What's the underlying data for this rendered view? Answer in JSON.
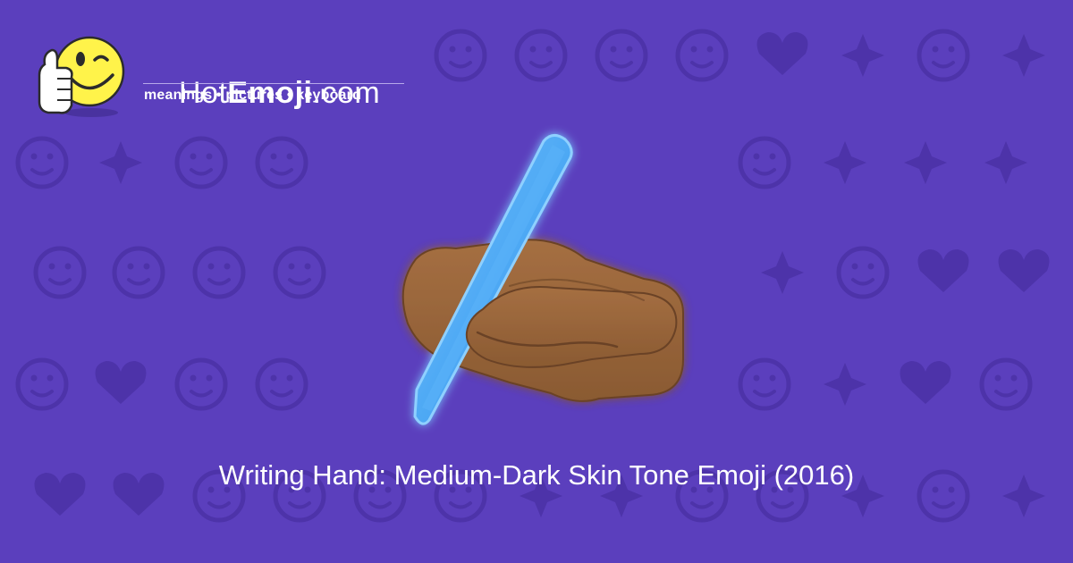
{
  "site": {
    "name_prefix": "Hot",
    "name_bold": "Emoji",
    "name_suffix": ".com",
    "tagline": "meanings • pictures • keyboard"
  },
  "emoji": {
    "caption": "Writing Hand: Medium-Dark Skin Tone Emoji (2016)",
    "hand_color": "#a06b3f",
    "pen_color": "#39a2f5"
  },
  "theme": {
    "background": "#5b3fbd",
    "pattern": "#4d33a9"
  },
  "background_icons": [
    "sleepy-face-icon",
    "smiling-face-icon",
    "winking-face-icon",
    "kissing-face-icon",
    "two-hearts-icon",
    "slight-smile-icon",
    "weary-face-icon",
    "ok-hand-icon",
    "relieved-face-icon",
    "eyes-icon",
    "smirk-face-icon",
    "relieved-face-icon",
    "grimace-face-icon",
    "recycle-icon",
    "raising-hands-icon",
    "musical-notes-icon",
    "monkey-icon",
    "sleeping-face-icon",
    "sad-face-icon",
    "grinning-face-icon",
    "sparkles-icon",
    "grinning-face-icon",
    "striped-heart-icon",
    "broken-heart-icon",
    "confused-face-icon",
    "striped-heart-icon",
    "tongue-face-icon",
    "frowning-face-icon",
    "tongue-face-icon",
    "raised-hand-icon",
    "heart-arrow-icon",
    "pouting-face-icon",
    "hearts-icon",
    "heart-icon",
    "monkey-icon",
    "screaming-face-icon",
    "devil-face-icon",
    "angry-face-icon",
    "left-arrow-icon",
    "fire-icon",
    "kiss-face-icon",
    "crying-face-icon",
    "party-popper-icon",
    "tongue-face-icon",
    "rose-icon",
    "sun-icon",
    "muscle-icon",
    "striped-heart-icon",
    "check-mark-icon",
    "grinning-face-icon",
    "smirk-face-icon",
    "cat-face-icon",
    "waving-hand-icon",
    "medical-mask-icon",
    "camera-icon",
    "frowning-face-icon",
    "grinning-face-icon",
    "heart-icon",
    "kissing-face-icon"
  ]
}
